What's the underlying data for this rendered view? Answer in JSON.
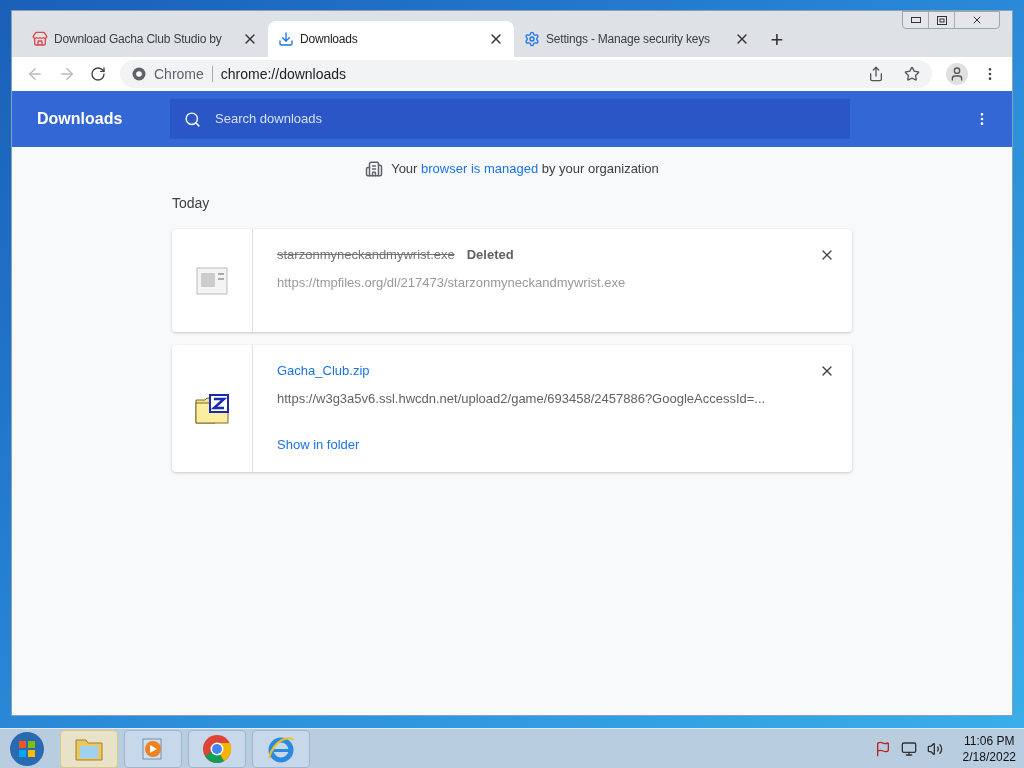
{
  "tabs": [
    {
      "kind": "store",
      "title": "Download Gacha Club Studio by",
      "selected": false
    },
    {
      "kind": "download",
      "title": "Downloads",
      "selected": true
    },
    {
      "kind": "settings",
      "title": "Settings - Manage security keys",
      "selected": false
    }
  ],
  "new_tab": "+",
  "address": {
    "site_label": "Chrome",
    "url": "chrome://downloads"
  },
  "header": {
    "title": "Downloads",
    "search_placeholder": "Search downloads"
  },
  "managed_notice": {
    "before": "Your",
    "link": "browser is managed",
    "after": "by your organization"
  },
  "section": "Today",
  "downloads": [
    {
      "kind": "deleted",
      "filename": "starzonmyneckandmywrist.exe",
      "status": "Deleted",
      "url": "https://tmpfiles.org/dl/217473/starzonmyneckandmywrist.exe"
    },
    {
      "kind": "complete",
      "filename": "Gacha_Club.zip",
      "url": "https://w3g3a5v6.ssl.hwcdn.net/upload2/game/693458/2457886?GoogleAccessId=...",
      "action": "Show in folder"
    }
  ],
  "taskbar": {
    "apps": [
      {
        "kind": "explorer",
        "selected": true
      },
      {
        "kind": "media",
        "selected": false
      },
      {
        "kind": "chrome",
        "selected": false
      },
      {
        "kind": "ie",
        "selected": false
      }
    ],
    "time": "11:06 PM",
    "date": "2/18/2022"
  }
}
